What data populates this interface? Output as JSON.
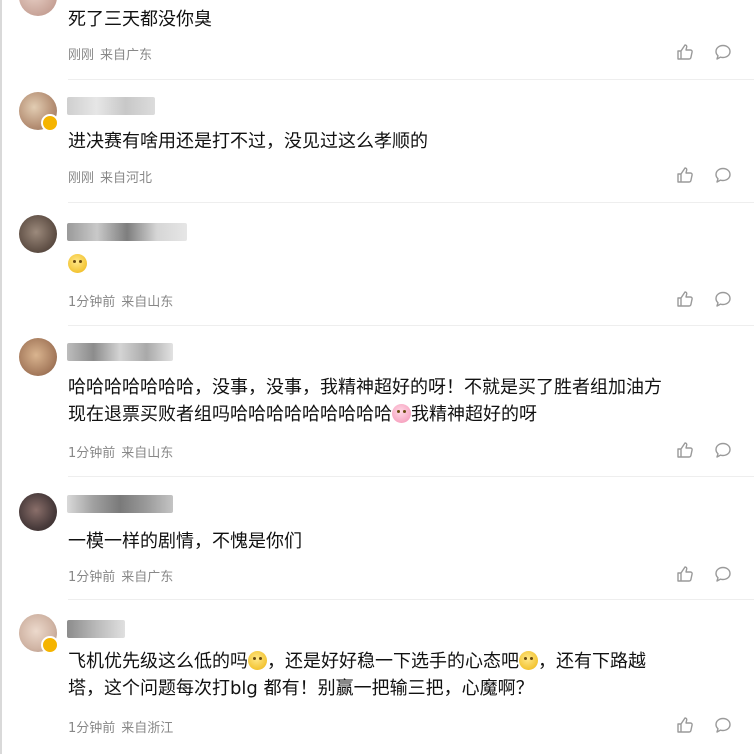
{
  "comments": [
    {
      "text": "死了三天都没你臭",
      "time": "刚刚",
      "location": "来自广东",
      "avatar_color": "#c79a8e"
    },
    {
      "text": "进决赛有啥用还是打不过，没见过这么孝顺的",
      "time": "刚刚",
      "location": "来自河北",
      "avatar_color": "#c9a98a"
    },
    {
      "text": "",
      "emoji": "smile-emoji",
      "time": "1分钟前",
      "location": "来自山东",
      "avatar_color": "#6b5a50"
    },
    {
      "text_line1": "哈哈哈哈哈哈哈，没事，没事，我精神超好的呀！不就是买了胜者组加油方",
      "text_line2a": "现在退票买败者组吗哈哈哈哈哈哈哈哈哈",
      "text_line2b": "我精神超好的呀",
      "emoji": "pig-emoji",
      "time": "1分钟前",
      "location": "来自山东",
      "avatar_color": "#a57a5c"
    },
    {
      "text": "一模一样的剧情，不愧是你们",
      "time": "1分钟前",
      "location": "来自广东",
      "avatar_color": "#4a3c3c"
    },
    {
      "text_part1": "飞机优先级这么低的吗",
      "text_part2": "，还是好好稳一下选手的心态吧",
      "text_part3": "，还有下路越",
      "text_line2": "塔，这个问题每次打blg 都有！别赢一把输三把，心魔啊？",
      "emoji1": "smirk-emoji",
      "emoji2": "grin-emoji",
      "time": "1分钟前",
      "location": "来自浙江",
      "avatar_color": "#d0b4a4"
    }
  ],
  "colors": {
    "meta": "#888888",
    "icon": "#9a9a9a",
    "divider": "#eeeeee"
  }
}
